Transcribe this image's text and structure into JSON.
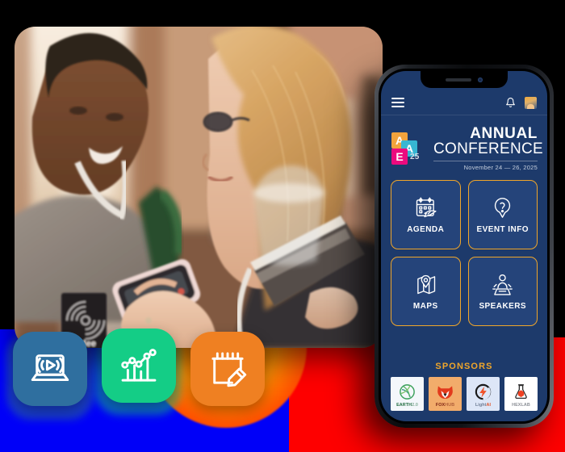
{
  "scene": {
    "description": "Conference mobile app promotional composite",
    "background_blocks": [
      "blue",
      "cyan",
      "red",
      "orange-sunburst"
    ]
  },
  "photo": {
    "alt": "Two women attendees at a conference looking at a smartphone",
    "badge_text": "ndee"
  },
  "app_icons": [
    {
      "name": "webcast-icon",
      "label": "Webcast",
      "color": "#2f6f9f"
    },
    {
      "name": "analytics-icon",
      "label": "Analytics",
      "color": "#14cd86"
    },
    {
      "name": "notes-icon",
      "label": "Notes",
      "color": "#ef8022"
    }
  ],
  "phone": {
    "app_bar": {
      "menu_label": "Menu",
      "notifications_label": "Notifications",
      "profile_label": "Profile"
    },
    "hero": {
      "logo": {
        "tile_a1": "A",
        "tile_a2": "A",
        "tile_e": "E",
        "year": "25"
      },
      "title_line1": "ANNUAL",
      "title_line2": "CONFERENCE",
      "date": "November 24 — 26, 2025"
    },
    "tiles": [
      {
        "icon": "calendar-plane-icon",
        "label": "AGENDA"
      },
      {
        "icon": "question-pin-icon",
        "label": "EVENT INFO"
      },
      {
        "icon": "map-pin-icon",
        "label": "MAPS"
      },
      {
        "icon": "podium-speaker-icon",
        "label": "SPEAKERS"
      }
    ],
    "sponsors": {
      "title": "SPONSORS",
      "items": [
        {
          "name": "EARTH",
          "suffix": "2.0",
          "icon": "globe-leaf-icon",
          "bg": "#f4f7fb",
          "text": "#1f6b3e"
        },
        {
          "name": "FOX",
          "suffix": "HUB",
          "icon": "fox-head-icon",
          "bg": "#f2ac6b",
          "text": "#7a1f10"
        },
        {
          "name": "Light",
          "suffix": "AI",
          "icon": "bolt-circle-icon",
          "bg": "#dde6f7",
          "text": "#6d7b93"
        },
        {
          "name": "HEX",
          "suffix": "LAB",
          "icon": "flask-hex-icon",
          "bg": "#ffffff",
          "text": "#8b8f96"
        }
      ]
    },
    "theme": {
      "screen_bg": "#1d3a6b",
      "tile_bg": "#25447a",
      "accent": "#f0a62a",
      "text": "#ffffff"
    }
  }
}
